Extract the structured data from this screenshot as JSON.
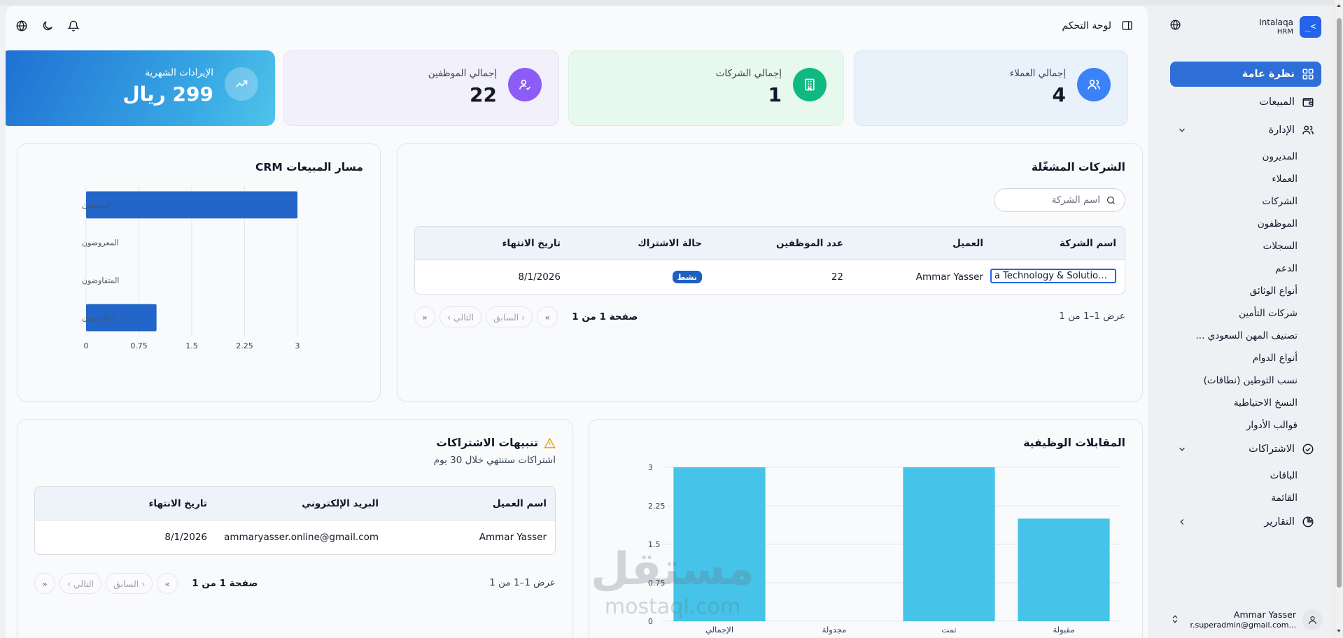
{
  "brand": {
    "title": "Intalaqa",
    "subtitle": "HRM",
    "logo_glyph": ">_"
  },
  "colors": {
    "primary": "#2d6fd6",
    "active_badge": "#1e5fc1",
    "interview_bar": "#45c3e8",
    "pipeline_bar": "#2166c8"
  },
  "sidebar": {
    "items": [
      {
        "label": "نظرة عامة",
        "icon": "grid-icon",
        "active": true
      },
      {
        "label": "المبيعات",
        "icon": "wallet-icon"
      }
    ],
    "admin": {
      "label": "الإدارة",
      "icon": "users-icon",
      "children": [
        "المديرون",
        "العملاء",
        "الشركات",
        "الموظفون",
        "السجلات",
        "الدعم",
        "أنواع الوثائق",
        "شركات التأمين",
        "تصنيف المهن السعودي ...",
        "أنواع الدوام",
        "نسب التوطين (نطاقات)",
        "النسخ الاحتياطية",
        "قوالب الأدوار"
      ]
    },
    "subscriptions": {
      "label": "الاشتراكات",
      "icon": "check-circle-icon",
      "children": [
        "الباقات",
        "القائمة"
      ]
    },
    "reports": {
      "label": "التقارير",
      "icon": "pie-chart-icon"
    },
    "user": {
      "name": "Ammar Yasser",
      "email": "r.superadmin@gmail.com..."
    }
  },
  "header": {
    "title": "لوحة التحكم"
  },
  "stats": {
    "clients": {
      "label": "إجمالي العملاء",
      "value": "4"
    },
    "companies": {
      "label": "إجمالي الشركات",
      "value": "1"
    },
    "employees": {
      "label": "إجمالي الموظفين",
      "value": "22"
    },
    "revenue": {
      "label": "الإيرادات الشهرية",
      "value": "299 ريال"
    }
  },
  "active_companies": {
    "title": "الشركات المشغّلة",
    "search_placeholder": "اسم الشركة",
    "columns": [
      "اسم الشركة",
      "العميل",
      "عدد الموظفين",
      "حالة الاشتراك",
      "تاريخ الانتهاء"
    ],
    "rows": [
      {
        "company": "a Technology & Solutions Co...",
        "client": "Ammar Yasser",
        "employees": "22",
        "status": "نشط",
        "end_date": "8/1/2026"
      }
    ],
    "pager": {
      "range": "عرض 1–1 من 1",
      "page": "صفحة 1 من 1",
      "prev": "السابق",
      "next": "التالي"
    }
  },
  "crm": {
    "title": "مسار المبيعات CRM",
    "chart_data": {
      "type": "bar",
      "orientation": "horizontal",
      "categories": [
        "المهتمون",
        "المعروضون",
        "المتفاوضون",
        "المكتسبون"
      ],
      "values": [
        3,
        0,
        0,
        1
      ],
      "xlim": [
        0,
        3
      ],
      "xticks": [
        "0",
        "0.75",
        "1.5",
        "2.25",
        "3"
      ],
      "grid": true
    }
  },
  "subs_alerts": {
    "title": "تنبيهات الاشتراكات",
    "subtitle": "اشتراكات ستنتهي خلال 30 يوم",
    "columns": [
      "اسم العميل",
      "البريد الإلكتروني",
      "تاريخ الانتهاء"
    ],
    "rows": [
      {
        "client": "Ammar Yasser",
        "email": "ammaryasser.online@gmail.com",
        "end_date": "8/1/2026"
      }
    ],
    "pager": {
      "range": "عرض 1–1 من 1",
      "page": "صفحة 1 من 1",
      "prev": "السابق",
      "next": "التالي"
    }
  },
  "interviews": {
    "title": "المقابلات الوظيفية",
    "chart_data": {
      "type": "bar",
      "categories": [
        "مقبولة",
        "تمت",
        "مجدولة",
        "الإجمالي"
      ],
      "values": [
        2,
        3,
        0,
        3
      ],
      "ylim": [
        0,
        3
      ],
      "yticks": [
        "0",
        "0.75",
        "1.5",
        "2.25",
        "3"
      ],
      "grid": true
    }
  },
  "watermark": {
    "text": "مستقل",
    "url": "mostaql.com"
  }
}
